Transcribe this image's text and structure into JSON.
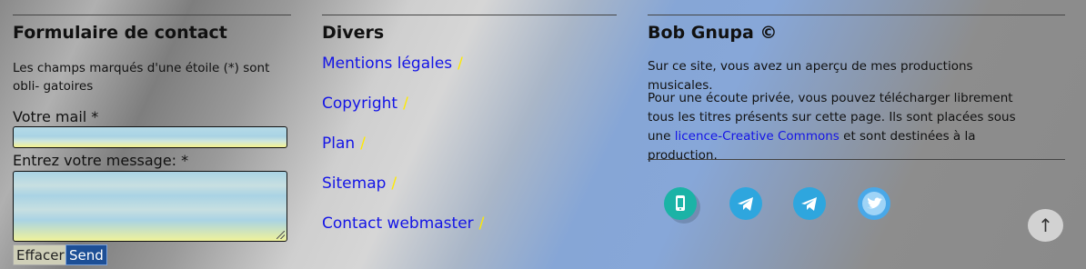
{
  "contact": {
    "title": "Formulaire de contact",
    "note": "Les champs marqués d'une étoile (*) sont obli- gatoires",
    "email_label": "Votre mail *",
    "email_value": "",
    "message_label": "Entrez votre message: *",
    "message_value": "",
    "reset_label": "Effacer",
    "send_label": "Send"
  },
  "divers": {
    "title": "Divers",
    "separator": "/",
    "links": [
      "Mentions légales",
      "Copyright",
      "Plan",
      "Sitemap",
      "Contact webmaster"
    ]
  },
  "about": {
    "title": "Bob Gnupa ©",
    "para1": "Sur ce site, vous avez un aperçu de mes productions musicales.",
    "para2_before": "Pour une écoute privée, vous pouvez télécharger librement tous les titres présents sur cette page. Ils sont placées sous une ",
    "para2_link": "licence-Creative Commons",
    "para2_after": " et sont destinées à la production."
  },
  "social": [
    {
      "icon": "phone-icon",
      "color": "#1bb3a6"
    },
    {
      "icon": "telegram-icon",
      "color": "#2ea6de"
    },
    {
      "icon": "telegram-icon",
      "color": "#2ea6de"
    },
    {
      "icon": "twitter-icon",
      "color": "#49a8e8"
    }
  ],
  "back_to_top": {
    "icon": "arrow-up-icon",
    "glyph": "↑"
  }
}
